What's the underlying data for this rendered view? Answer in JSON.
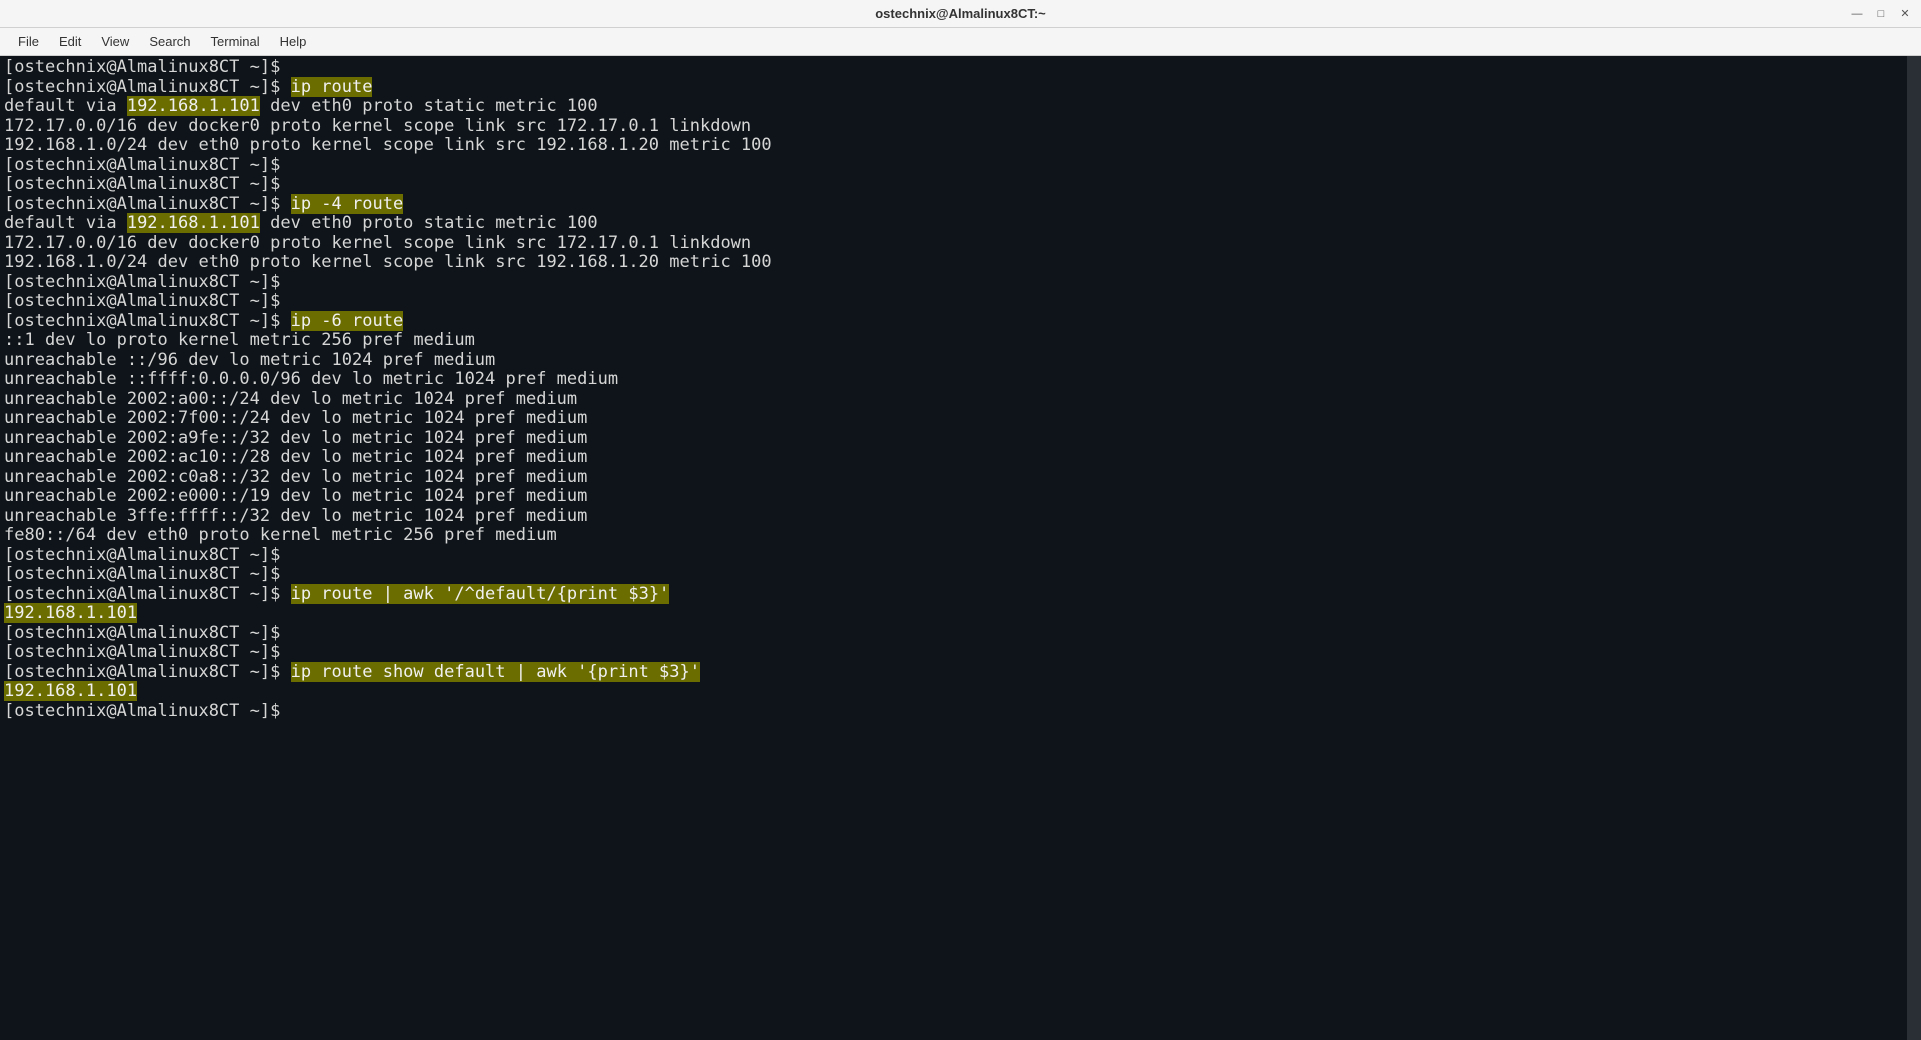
{
  "window": {
    "title": "ostechnix@Almalinux8CT:~",
    "controls": {
      "min": "—",
      "max": "□",
      "close": "✕"
    }
  },
  "menu": {
    "file": "File",
    "edit": "Edit",
    "view": "View",
    "search": "Search",
    "terminal": "Terminal",
    "help": "Help"
  },
  "prompt": "[ostechnix@Almalinux8CT ~]$",
  "cmds": {
    "ip_route": "ip route",
    "ip4_route": "ip -4 route",
    "ip6_route": "ip -6 route",
    "awk1": "ip route | awk '/^default/{print $3}'",
    "awk2": "ip route show default | awk '{print $3}'"
  },
  "out": {
    "default_pre": "default via ",
    "gateway": "192.168.1.101",
    "default_post": " dev eth0 proto static metric 100",
    "docker": "172.17.0.0/16 dev docker0 proto kernel scope link src 172.17.0.1 linkdown",
    "lan": "192.168.1.0/24 dev eth0 proto kernel scope link src 192.168.1.20 metric 100",
    "v6_lo": "::1 dev lo proto kernel metric 256 pref medium",
    "v6_u1": "unreachable ::/96 dev lo metric 1024 pref medium",
    "v6_u2": "unreachable ::ffff:0.0.0.0/96 dev lo metric 1024 pref medium",
    "v6_u3": "unreachable 2002:a00::/24 dev lo metric 1024 pref medium",
    "v6_u4": "unreachable 2002:7f00::/24 dev lo metric 1024 pref medium",
    "v6_u5": "unreachable 2002:a9fe::/32 dev lo metric 1024 pref medium",
    "v6_u6": "unreachable 2002:ac10::/28 dev lo metric 1024 pref medium",
    "v6_u7": "unreachable 2002:c0a8::/32 dev lo metric 1024 pref medium",
    "v6_u8": "unreachable 2002:e000::/19 dev lo metric 1024 pref medium",
    "v6_u9": "unreachable 3ffe:ffff::/32 dev lo metric 1024 pref medium",
    "v6_fe80": "fe80::/64 dev eth0 proto kernel metric 256 pref medium",
    "gw_only": "192.168.1.101"
  }
}
